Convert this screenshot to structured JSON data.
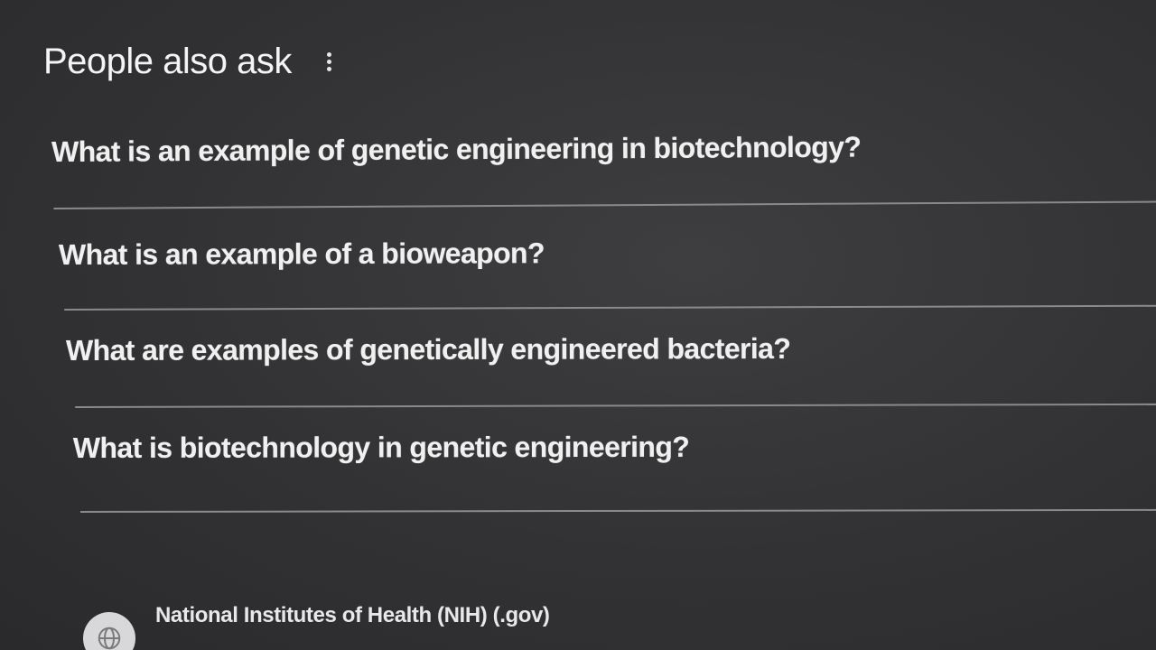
{
  "people_also_ask": {
    "title": "People also ask",
    "more_icon": "three-dots-vertical-icon",
    "questions": [
      {
        "text": "What is an example of genetic engineering in biotechnology?"
      },
      {
        "text": "What is an example of a bioweapon?"
      },
      {
        "text": "What are examples of genetically engineered bacteria?"
      },
      {
        "text": "What is biotechnology in genetic engineering?"
      }
    ]
  },
  "search_result": {
    "favicon": "globe-icon",
    "source_name": "National Institutes of Health (NIH) (.gov)"
  }
}
